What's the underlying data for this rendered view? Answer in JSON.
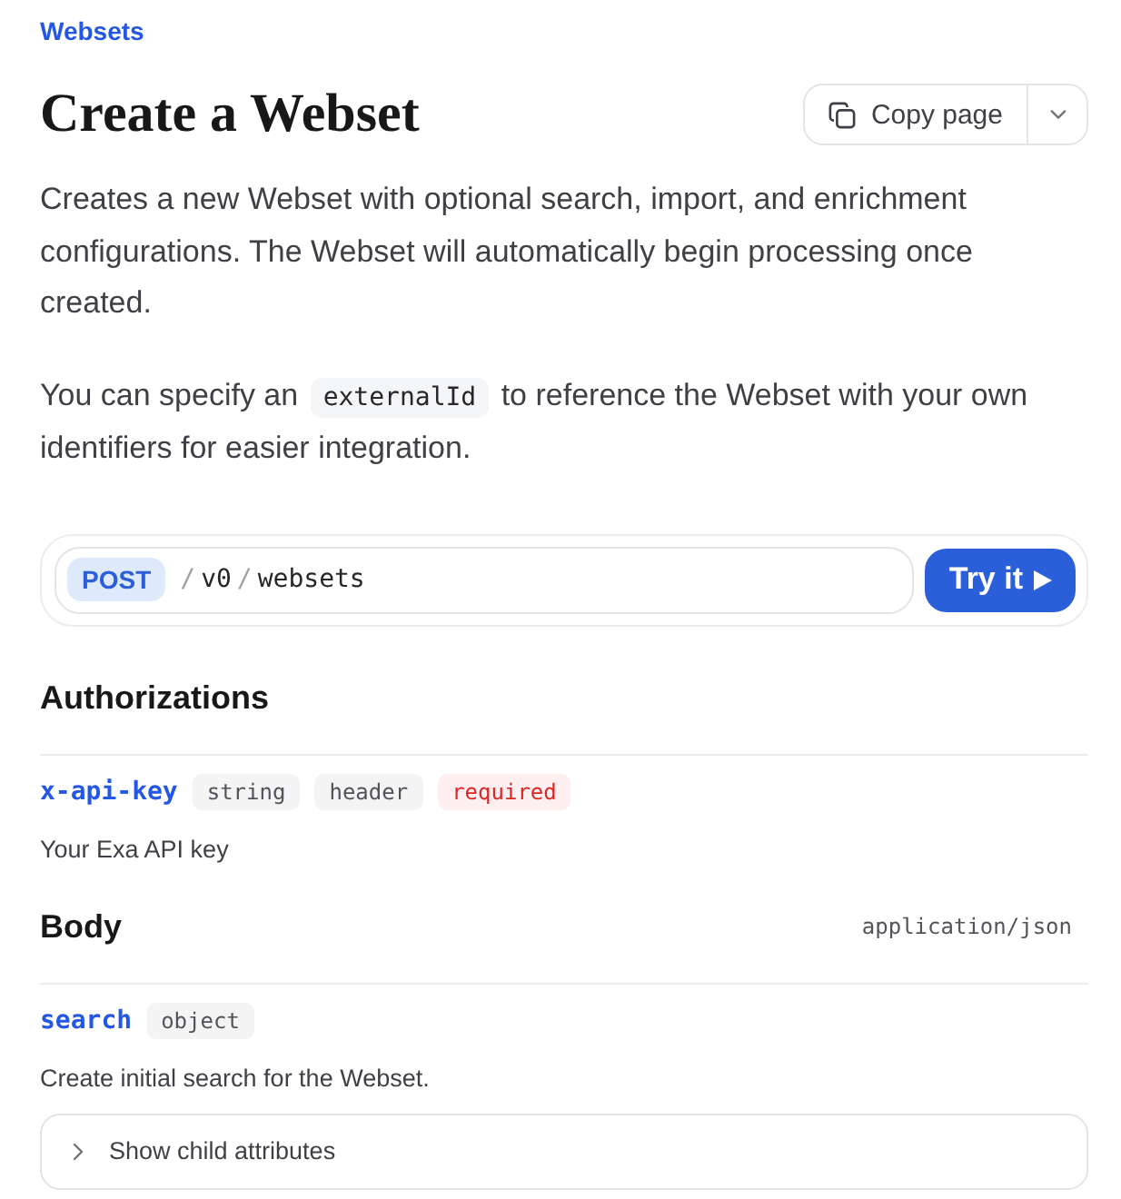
{
  "breadcrumb": "Websets",
  "title": "Create a Webset",
  "copy_button": {
    "label": "Copy page"
  },
  "paragraphs": [
    {
      "segments": [
        {
          "kind": "text",
          "text": "Creates a new Webset with optional search, import, and enrichment configurations. The Webset will automatically begin processing once created."
        }
      ]
    },
    {
      "segments": [
        {
          "kind": "text",
          "text": "You can specify an "
        },
        {
          "kind": "code",
          "text": "externalId"
        },
        {
          "kind": "text",
          "text": " to reference the Webset with your own identifiers for easier integration."
        }
      ]
    }
  ],
  "endpoint": {
    "method": "POST",
    "path": [
      {
        "kind": "separator",
        "text": "/"
      },
      {
        "kind": "segment",
        "text": "v0"
      },
      {
        "kind": "separator",
        "text": "/"
      },
      {
        "kind": "segment",
        "text": "websets"
      }
    ],
    "button": "Try it"
  },
  "sections": [
    {
      "title": "Authorizations",
      "params": [
        {
          "name": "x-api-key",
          "badges": [
            {
              "kind": "type",
              "text": "string"
            },
            {
              "kind": "location",
              "text": "header"
            },
            {
              "kind": "required",
              "text": "required"
            }
          ],
          "description": "Your Exa API key"
        }
      ]
    },
    {
      "title": "Body",
      "content_type": "application/json",
      "params": [
        {
          "name": "search",
          "badges": [
            {
              "kind": "type",
              "text": "object"
            }
          ],
          "description": "Create initial search for the Webset.",
          "child_toggle": {
            "label": "Show child attributes",
            "expanded": false
          }
        }
      ]
    }
  ]
}
